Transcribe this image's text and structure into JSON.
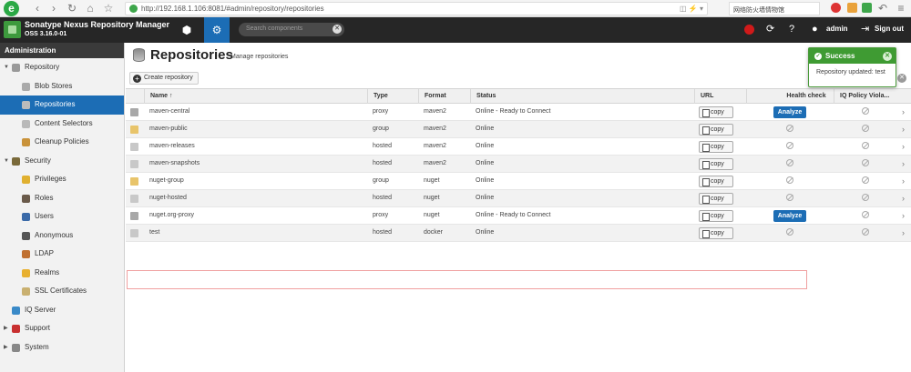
{
  "browser": {
    "url": "http://192.168.1.106:8081/#admin/repository/repositories",
    "search_text": "网络防火墙情物馆"
  },
  "header": {
    "title": "Sonatype Nexus Repository Manager",
    "version": "OSS 3.16.0-01",
    "search_placeholder": "Search components",
    "user": "admin",
    "signout": "Sign out"
  },
  "sidebar": {
    "heading": "Administration",
    "items": [
      {
        "label": "Repository",
        "level": 0,
        "expanded": true,
        "icon": "database-icon"
      },
      {
        "label": "Blob Stores",
        "level": 1,
        "icon": "blob-stores-icon"
      },
      {
        "label": "Repositories",
        "level": 1,
        "selected": true,
        "icon": "repositories-icon"
      },
      {
        "label": "Content Selectors",
        "level": 1,
        "icon": "content-selectors-icon"
      },
      {
        "label": "Cleanup Policies",
        "level": 1,
        "icon": "broom-icon"
      },
      {
        "label": "Security",
        "level": 0,
        "expanded": true,
        "icon": "eye-icon"
      },
      {
        "label": "Privileges",
        "level": 1,
        "icon": "medal-icon"
      },
      {
        "label": "Roles",
        "level": 1,
        "icon": "roles-icon"
      },
      {
        "label": "Users",
        "level": 1,
        "icon": "users-icon"
      },
      {
        "label": "Anonymous",
        "level": 1,
        "icon": "anonymous-icon"
      },
      {
        "label": "LDAP",
        "level": 1,
        "icon": "ldap-icon"
      },
      {
        "label": "Realms",
        "level": 1,
        "icon": "realms-icon"
      },
      {
        "label": "SSL Certificates",
        "level": 1,
        "icon": "certificate-icon"
      },
      {
        "label": "IQ Server",
        "level": 0,
        "icon": "iq-server-icon"
      },
      {
        "label": "Support",
        "level": 0,
        "collapsed": true,
        "icon": "support-icon"
      },
      {
        "label": "System",
        "level": 0,
        "collapsed": true,
        "icon": "gear-icon"
      }
    ]
  },
  "main": {
    "title": "Repositories",
    "subtitle": "Manage repositories",
    "create_label": "Create repository",
    "columns": {
      "name": "Name ↑",
      "type": "Type",
      "format": "Format",
      "status": "Status",
      "url": "URL",
      "health": "Health check",
      "iq": "IQ Policy Viola..."
    },
    "copy_label": "copy",
    "analyze_label": "Analyze",
    "rows": [
      {
        "name": "maven-central",
        "type": "proxy",
        "format": "maven2",
        "status": "Online - Ready to Connect",
        "analyze": true
      },
      {
        "name": "maven-public",
        "type": "group",
        "format": "maven2",
        "status": "Online",
        "analyze": false
      },
      {
        "name": "maven-releases",
        "type": "hosted",
        "format": "maven2",
        "status": "Online",
        "analyze": false
      },
      {
        "name": "maven-snapshots",
        "type": "hosted",
        "format": "maven2",
        "status": "Online",
        "analyze": false
      },
      {
        "name": "nuget-group",
        "type": "group",
        "format": "nuget",
        "status": "Online",
        "analyze": false
      },
      {
        "name": "nuget-hosted",
        "type": "hosted",
        "format": "nuget",
        "status": "Online",
        "analyze": false
      },
      {
        "name": "nuget.org-proxy",
        "type": "proxy",
        "format": "nuget",
        "status": "Online - Ready to Connect",
        "analyze": true
      },
      {
        "name": "test",
        "type": "hosted",
        "format": "docker",
        "status": "Online",
        "analyze": false
      }
    ]
  },
  "toast": {
    "title": "Success",
    "message": "Repository updated: test"
  },
  "colors": {
    "accent": "#1c6db5",
    "success": "#3f9b33",
    "header": "#262626"
  }
}
